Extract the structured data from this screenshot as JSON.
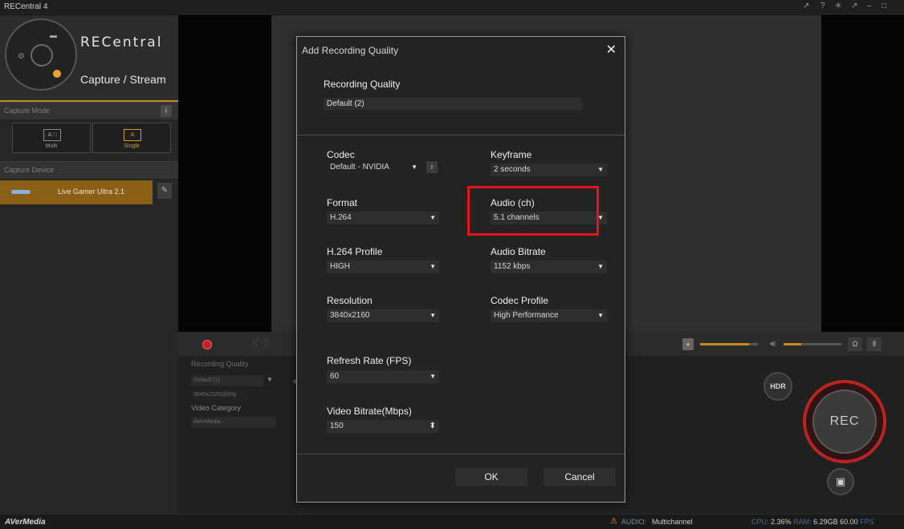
{
  "window": {
    "title": "RECentral 4",
    "controls": [
      "↗",
      "?",
      "✳",
      "↗",
      "–",
      "□"
    ]
  },
  "sidebar": {
    "brand": "RECentral",
    "mode_title": "Capture / Stream",
    "capture_mode_label": "Capture Mode",
    "info_label": "i",
    "modes": [
      {
        "label": "Multi",
        "icon": "A □",
        "active": false
      },
      {
        "label": "Single",
        "icon": "A",
        "active": true
      }
    ],
    "capture_device_label": "Capture Device",
    "device": {
      "name": "Live Gamer Ultra 2.1",
      "edit_icon": "✎"
    }
  },
  "bottom_panel": {
    "stream_icon": "((○))",
    "recording_quality_label": "Recording Quality",
    "quality_value": "Default (1)",
    "quality_detail": "3840x2160@60p",
    "add_label": "+",
    "caret": "▼",
    "video_category_label": "Video Category",
    "video_category_value": "AVerMedia",
    "mic_icon": "●",
    "speaker_icon": "◀)",
    "headphone_icon": "Ω",
    "mixer_icon": "⫴",
    "hdr_label": "HDR",
    "rec_label": "REC",
    "snapshot_icon": "▣",
    "mic_level": 0.85,
    "speaker_level": 0.3
  },
  "modal": {
    "title": "Add Recording Quality",
    "close_symbol": "✕",
    "recording_quality_label": "Recording Quality",
    "recording_quality_value": "Default (2)",
    "codec": {
      "label": "Codec",
      "value": "Default - NVIDIA",
      "info": "i"
    },
    "keyframe": {
      "label": "Keyframe",
      "value": "2 seconds"
    },
    "format": {
      "label": "Format",
      "value": "H.264"
    },
    "audio_ch": {
      "label": "Audio (ch)",
      "value": "5.1 channels"
    },
    "h264_profile": {
      "label": "H.264 Profile",
      "value": "HIGH"
    },
    "audio_bitrate": {
      "label": "Audio Bitrate",
      "value": "1152 kbps"
    },
    "resolution": {
      "label": "Resolution",
      "value": "3840x2160"
    },
    "codec_profile": {
      "label": "Codec Profile",
      "value": "High Performance"
    },
    "refresh_rate": {
      "label": "Refresh Rate (FPS)",
      "value": "60"
    },
    "video_bitrate": {
      "label": "Video Bitrate(Mbps)",
      "value": "150"
    },
    "caret": "▼",
    "spin": "⬍",
    "ok_label": "OK",
    "cancel_label": "Cancel"
  },
  "status": {
    "brand": "AVerMedia",
    "warning_icon": "⚠",
    "audio_label": "AUDIO:",
    "audio_value": "Multichannel",
    "cpu_label": "CPU:",
    "cpu_value": "2.36%",
    "ram_label": "RAM:",
    "ram_value": "6.29GB",
    "fps_value": "60.00",
    "fps_label": "FPS"
  },
  "colors": {
    "accent": "#c88a1e",
    "record_red": "#c42024",
    "highlight_red": "#e8121b"
  }
}
